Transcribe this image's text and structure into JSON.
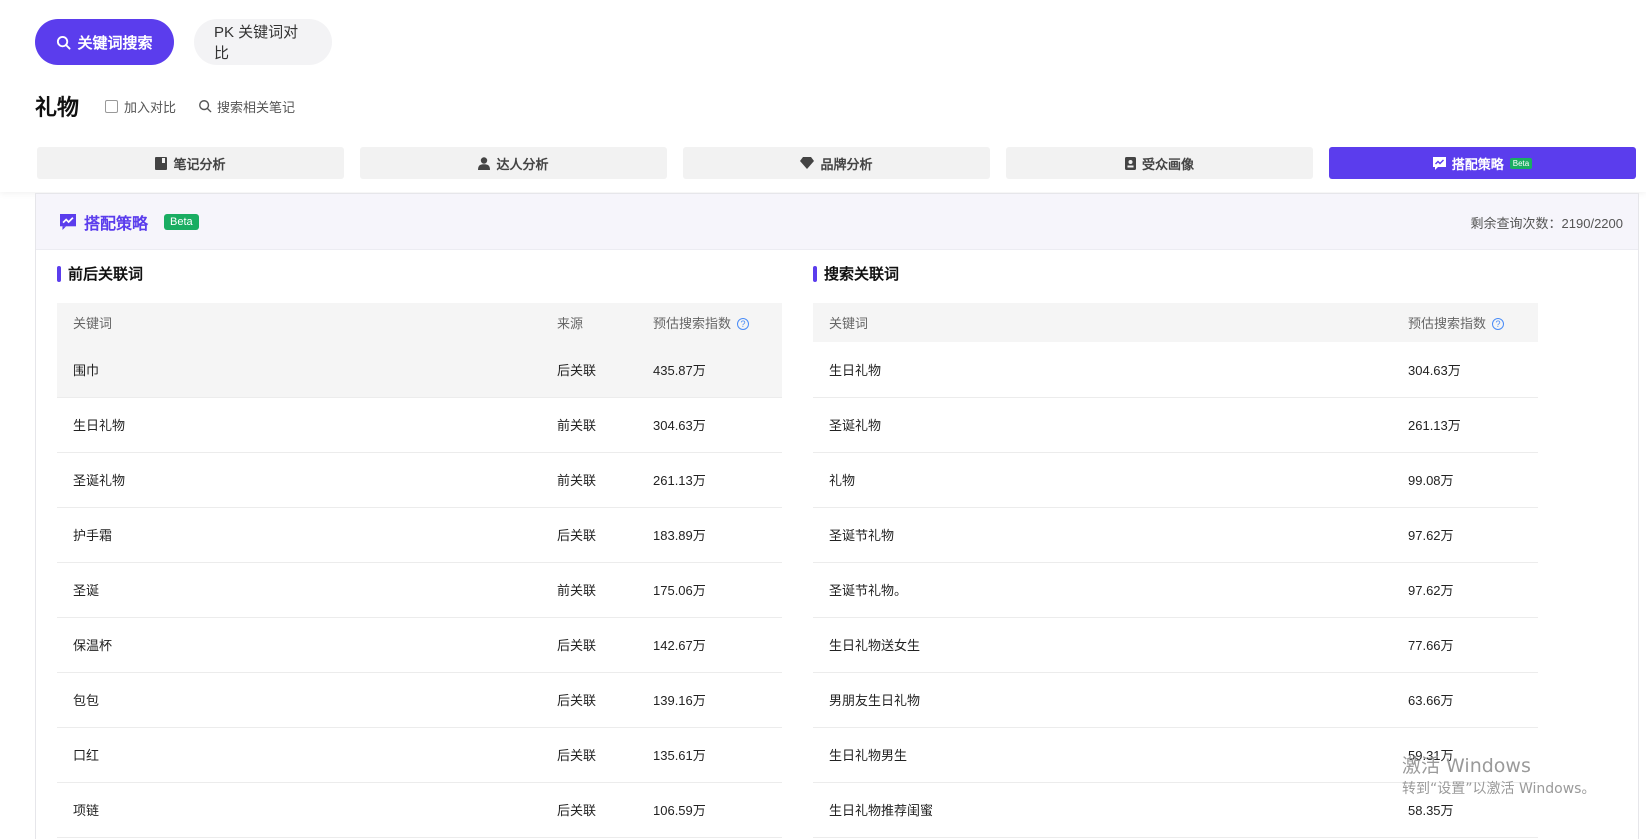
{
  "mode_tabs": {
    "keyword_search": "关键词搜索",
    "pk_compare": "PK 关键词对比"
  },
  "keyword": {
    "title": "礼物",
    "add_compare": "加入对比",
    "search_notes": "搜索相关笔记"
  },
  "analysis_tabs": [
    {
      "label": "笔记分析",
      "icon": "note-icon"
    },
    {
      "label": "达人分析",
      "icon": "person-icon"
    },
    {
      "label": "品牌分析",
      "icon": "diamond-icon"
    },
    {
      "label": "受众画像",
      "icon": "profile-icon"
    },
    {
      "label": "搭配策略",
      "icon": "strategy-icon",
      "badge": "Beta"
    }
  ],
  "panel": {
    "title": "搭配策略",
    "badge": "Beta",
    "remaining": "剩余查询次数：2190/2200"
  },
  "left_table": {
    "title": "前后关联词",
    "headers": {
      "keyword": "关键词",
      "source": "来源",
      "index": "预估搜索指数"
    },
    "rows": [
      {
        "keyword": "围巾",
        "source": "后关联",
        "index": "435.87万"
      },
      {
        "keyword": "生日礼物",
        "source": "前关联",
        "index": "304.63万"
      },
      {
        "keyword": "圣诞礼物",
        "source": "前关联",
        "index": "261.13万"
      },
      {
        "keyword": "护手霜",
        "source": "后关联",
        "index": "183.89万"
      },
      {
        "keyword": "圣诞",
        "source": "前关联",
        "index": "175.06万"
      },
      {
        "keyword": "保温杯",
        "source": "后关联",
        "index": "142.67万"
      },
      {
        "keyword": "包包",
        "source": "后关联",
        "index": "139.16万"
      },
      {
        "keyword": "口红",
        "source": "后关联",
        "index": "135.61万"
      },
      {
        "keyword": "项链",
        "source": "后关联",
        "index": "106.59万"
      }
    ]
  },
  "right_table": {
    "title": "搜索关联词",
    "headers": {
      "keyword": "关键词",
      "index": "预估搜索指数"
    },
    "rows": [
      {
        "keyword": "生日礼物",
        "index": "304.63万"
      },
      {
        "keyword": "圣诞礼物",
        "index": "261.13万"
      },
      {
        "keyword": "礼物",
        "index": "99.08万"
      },
      {
        "keyword": "圣诞节礼物",
        "index": "97.62万"
      },
      {
        "keyword": "圣诞节礼物。",
        "index": "97.62万"
      },
      {
        "keyword": "生日礼物送女生",
        "index": "77.66万"
      },
      {
        "keyword": "男朋友生日礼物",
        "index": "63.66万"
      },
      {
        "keyword": "生日礼物男生",
        "index": "59.31万"
      },
      {
        "keyword": "生日礼物推荐闺蜜",
        "index": "58.35万"
      }
    ]
  },
  "watermark": {
    "line1": "激活 Windows",
    "line2": "转到“设置”以激活 Windows。"
  }
}
